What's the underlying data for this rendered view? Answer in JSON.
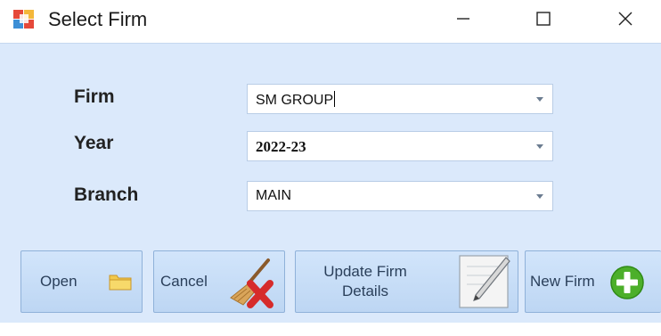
{
  "window": {
    "title": "Select Firm",
    "controls": {
      "minimize_icon": "minimize-icon",
      "maximize_icon": "maximize-icon",
      "close_icon": "close-icon"
    }
  },
  "form": {
    "firm": {
      "label": "Firm",
      "value": "SM GROUP"
    },
    "year": {
      "label": "Year",
      "value": "2022-23"
    },
    "branch": {
      "label": "Branch",
      "value": "MAIN"
    }
  },
  "buttons": {
    "open": {
      "label": "Open",
      "icon": "folder-icon"
    },
    "cancel": {
      "label": "Cancel",
      "icon": "broom-cancel-icon"
    },
    "update": {
      "label_line1": "Update Firm",
      "label_line2": "Details",
      "icon": "document-edit-icon"
    },
    "new_firm": {
      "label": "New Firm",
      "icon": "add-icon"
    }
  },
  "colors": {
    "client_background": "#dbe9fb",
    "button_background": "#c6dcf6",
    "button_border": "#8fb1d9",
    "add_icon_green": "#4caf2a",
    "cancel_icon_red": "#d62b2b",
    "folder_yellow": "#f2c94c"
  }
}
